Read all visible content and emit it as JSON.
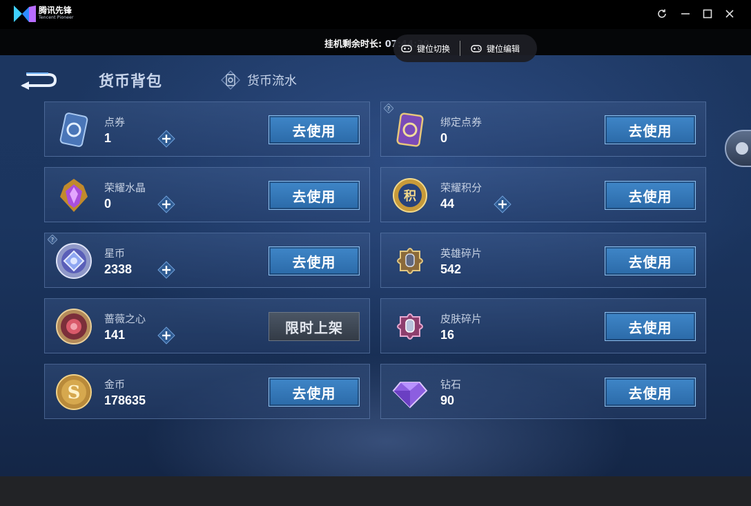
{
  "window": {
    "logo_text": "腾讯先锋",
    "logo_sub": "Tencent Pioneer",
    "controls": [
      "refresh-icon",
      "minimize-icon",
      "maximize-icon",
      "close-icon"
    ]
  },
  "overlay": {
    "timer_label": "挂机剩余时长: ",
    "timer_value": "07:44:39",
    "key_switch": "键位切换",
    "key_edit": "键位编辑"
  },
  "page": {
    "title": "货币背包",
    "flow_tab": "货币流水"
  },
  "colors": {
    "use_button": "#3577b8",
    "card_bg": "#2c4a78",
    "background": "#1b355f"
  },
  "currencies": [
    {
      "name": "点券",
      "amount": "1",
      "action": "去使用",
      "plus": true,
      "icon": "ticket-coupon-icon",
      "help": false
    },
    {
      "name": "绑定点券",
      "amount": "0",
      "action": "去使用",
      "plus": false,
      "icon": "bound-coupon-icon",
      "help": true
    },
    {
      "name": "荣耀水晶",
      "amount": "0",
      "action": "去使用",
      "plus": true,
      "icon": "glory-crystal-icon",
      "help": false
    },
    {
      "name": "荣耀积分",
      "amount": "44",
      "action": "去使用",
      "plus": true,
      "icon": "glory-points-icon",
      "help": false
    },
    {
      "name": "星币",
      "amount": "2338",
      "action": "去使用",
      "plus": true,
      "icon": "star-coin-icon",
      "help": true
    },
    {
      "name": "英雄碎片",
      "amount": "542",
      "action": "去使用",
      "plus": false,
      "icon": "hero-fragment-icon",
      "help": false
    },
    {
      "name": "蔷薇之心",
      "amount": "141",
      "action": "限时上架",
      "plus": true,
      "icon": "rose-heart-icon",
      "help": false
    },
    {
      "name": "皮肤碎片",
      "amount": "16",
      "action": "去使用",
      "plus": false,
      "icon": "skin-fragment-icon",
      "help": false
    },
    {
      "name": "金币",
      "amount": "178635",
      "action": "去使用",
      "plus": false,
      "icon": "gold-coin-icon",
      "help": false
    },
    {
      "name": "钻石",
      "amount": "90",
      "action": "去使用",
      "plus": false,
      "icon": "diamond-icon",
      "help": false
    }
  ]
}
